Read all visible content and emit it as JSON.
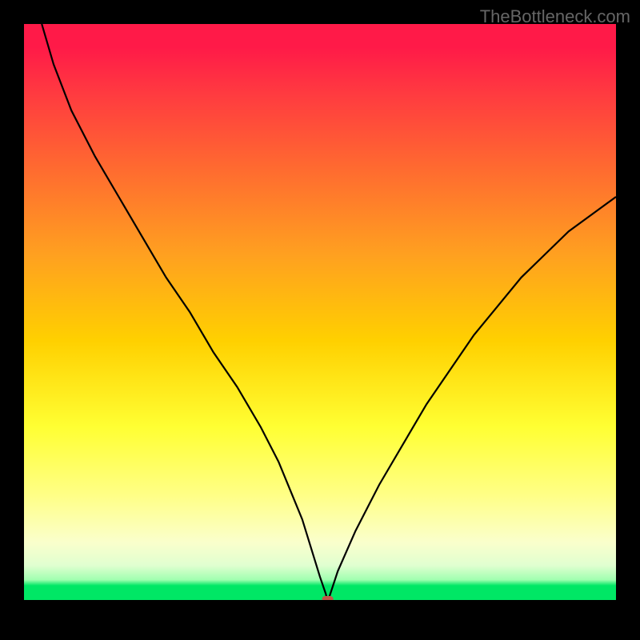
{
  "watermark": "TheBottleneck.com",
  "chart_data": {
    "type": "line",
    "title": "",
    "xlabel": "",
    "ylabel": "",
    "xlim": [
      0,
      100
    ],
    "ylim": [
      0,
      100
    ],
    "grid": false,
    "series": [
      {
        "name": "curve",
        "x": [
          3,
          5,
          8,
          12,
          16,
          20,
          24,
          28,
          32,
          36,
          40,
          43,
          45,
          47,
          48.5,
          50,
          51,
          51.2,
          51.3,
          51.4,
          53,
          56,
          60,
          64,
          68,
          72,
          76,
          80,
          84,
          88,
          92,
          96,
          100
        ],
        "y": [
          100,
          93,
          85,
          77,
          70,
          63,
          56,
          50,
          43,
          37,
          30,
          24,
          19,
          14,
          9,
          4,
          1,
          0,
          0,
          0,
          5,
          12,
          20,
          27,
          34,
          40,
          46,
          51,
          56,
          60,
          64,
          67,
          70
        ]
      }
    ],
    "marker": {
      "x": 51.3,
      "y": 0
    },
    "background": {
      "gradient": [
        "#ff1a48",
        "#ff3a40",
        "#ff6a30",
        "#ffa020",
        "#ffd000",
        "#ffff33",
        "#ffff88",
        "#faffcc",
        "#e0ffd0",
        "#a0ffb0",
        "#00e765"
      ]
    }
  }
}
